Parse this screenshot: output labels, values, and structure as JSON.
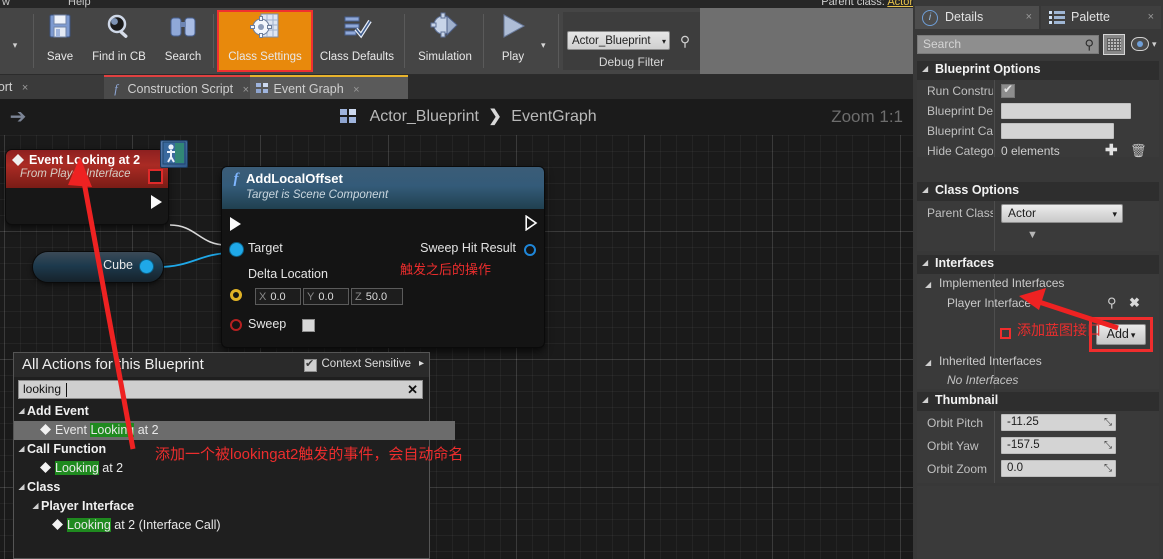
{
  "menubar": {
    "window": "w",
    "help": "Help"
  },
  "toolbar": {
    "items": [
      {
        "label": "Save",
        "icon": "floppy-disk-icon",
        "glyph": "💾"
      },
      {
        "label": "Find in CB",
        "icon": "magnifier-icon",
        "glyph": "🔍"
      },
      {
        "label": "Search",
        "icon": "binoculars-icon",
        "glyph": "🔭"
      },
      {
        "label": "Class Settings",
        "icon": "gear-document-icon",
        "glyph": "⚙"
      },
      {
        "label": "Class Defaults",
        "icon": "checklist-icon",
        "glyph": "🗒"
      },
      {
        "label": "Simulation",
        "icon": "gear-play-icon",
        "glyph": "⚙"
      },
      {
        "label": "Play",
        "icon": "play-icon",
        "glyph": "▶"
      }
    ],
    "active_item": "Class Settings",
    "debug_filter": {
      "label": "Debug Filter",
      "value": "Actor_Blueprint",
      "search_icon": "magnifier-icon"
    },
    "parent_class_text": "Parent class: ",
    "parent_class_value": "Actor"
  },
  "tabs": [
    {
      "label": "Viewport",
      "icon": "viewport-icon",
      "close": "×"
    },
    {
      "label": "Construction Script",
      "icon": "function-icon",
      "close": "×"
    },
    {
      "label": "Event Graph",
      "icon": "event-graph-icon",
      "close": "×"
    }
  ],
  "graph": {
    "back_arrow_icon": "arrow-right-icon",
    "breadcrumb": {
      "icon": "event-graph-icon",
      "root": "Actor_Blueprint",
      "separator": "❯",
      "leaf": "EventGraph"
    },
    "zoom_label": "Zoom 1:1",
    "event_node": {
      "title": "Event Looking at 2",
      "subtitle": "From Player Interface",
      "badge_icon": "actor-interface-badge-icon",
      "badge_glyph": "🧍",
      "exec_out_icon": "exec-pin-icon"
    },
    "cube_node": {
      "label": "Cube",
      "pin_icon": "object-pin-icon"
    },
    "function_node": {
      "title": "AddLocalOffset",
      "subtitle": "Target is Scene Component",
      "fn_icon": "function-f-icon",
      "exec_in_icon": "exec-pin-icon",
      "exec_out_icon": "exec-pin-icon",
      "inputs": [
        {
          "name": "Target",
          "pin": "object-pin-icon"
        },
        {
          "name": "Delta Location",
          "pin": "struct-pin-icon"
        },
        {
          "name": "Sweep",
          "pin": "bool-pin-icon"
        }
      ],
      "outputs": [
        {
          "name": "Sweep Hit Result",
          "pin": "struct-pin-icon"
        }
      ],
      "delta_location": {
        "x_axis": "X",
        "x": "0.0",
        "y_axis": "Y",
        "y": "0.0",
        "z_axis": "Z",
        "z": "50.0"
      },
      "sweep_checked": false
    }
  },
  "actions_menu": {
    "title": "All Actions for this Blueprint",
    "context_sensitive_label": "Context Sensitive",
    "context_sensitive_checked": true,
    "context_arrow": "▸",
    "search_value": "looking",
    "clear_icon": "✕",
    "tree": [
      {
        "depth": 0,
        "type": "category",
        "twisty": "◢",
        "label": "Add Event"
      },
      {
        "depth": 1,
        "type": "item",
        "icon": "event-diamond-icon",
        "pre": "Event ",
        "hl": "Looking",
        "post": " at 2",
        "selected": true
      },
      {
        "depth": 0,
        "type": "category",
        "twisty": "◢",
        "label": "Call Function"
      },
      {
        "depth": 1,
        "type": "item",
        "icon": "event-diamond-icon",
        "pre": "",
        "hl": "Looking",
        "post": " at 2",
        "selected": false
      },
      {
        "depth": 0,
        "type": "category",
        "twisty": "◢",
        "label": "Class"
      },
      {
        "depth": 1,
        "type": "category",
        "twisty": "◢",
        "label": "Player Interface"
      },
      {
        "depth": 2,
        "type": "item",
        "icon": "event-diamond-icon",
        "pre": "",
        "hl": "Looking",
        "post": " at 2 (Interface Call)",
        "selected": false
      }
    ]
  },
  "annotations": [
    {
      "id": "after-trigger",
      "text": "触发之后的操作",
      "color": "#ec2d2d"
    },
    {
      "id": "auto-name",
      "text": "添加一个被lookingat2触发的事件，会自动命名",
      "color": "#ec2d2d"
    },
    {
      "id": "add-blueprint-interface",
      "text": "添加蓝图接口",
      "color": "#ec2d2d"
    }
  ],
  "right_panel": {
    "tabs": [
      {
        "label": "Details",
        "icon": "details-info-icon",
        "close": "×",
        "active": true
      },
      {
        "label": "Palette",
        "icon": "palette-list-icon",
        "close": "×",
        "active": false
      }
    ],
    "search": {
      "placeholder": "Search",
      "icon": "magnifier-icon"
    },
    "grid_button_icon": "grid-view-icon",
    "eye_icon": "eye-icon",
    "eye_caret": "▾",
    "sections": [
      {
        "id": "blueprint-options",
        "title": "Blueprint Options",
        "twisty": "◢",
        "rows": [
          {
            "label": "Run Constru",
            "type": "checkbox",
            "checked": true
          },
          {
            "label": "Blueprint De",
            "type": "text",
            "value": ""
          },
          {
            "label": "Blueprint Ca",
            "type": "text",
            "value": ""
          },
          {
            "label": "Hide Catego",
            "type": "array",
            "value": "0 elements",
            "add_icon": "plus-icon",
            "delete_icon": "trash-icon"
          }
        ]
      },
      {
        "id": "class-options",
        "title": "Class Options",
        "twisty": "◢",
        "rows": [
          {
            "label": "Parent Class",
            "type": "combo",
            "value": "Actor",
            "caret": "▾"
          }
        ],
        "expander": "▼"
      },
      {
        "id": "interfaces",
        "title": "Interfaces",
        "twisty": "◢",
        "groups": [
          {
            "label": "Implemented Interfaces",
            "twisty": "◢",
            "items": [
              "Player Interface"
            ],
            "row_icons": {
              "browse": "magnifier-icon",
              "remove": "close-x-icon"
            },
            "add_button": {
              "label": "Add",
              "caret": "▾"
            }
          },
          {
            "label": "Inherited Interfaces",
            "twisty": "◢",
            "items": [
              "No Interfaces"
            ],
            "italic": true
          }
        ]
      },
      {
        "id": "thumbnail",
        "title": "Thumbnail",
        "twisty": "◢",
        "rows": [
          {
            "label": "Orbit Pitch",
            "type": "number",
            "value": "-11.25",
            "spinner": "⤡"
          },
          {
            "label": "Orbit Yaw",
            "type": "number",
            "value": "-157.5",
            "spinner": "⤡"
          },
          {
            "label": "Orbit Zoom",
            "type": "number",
            "value": "0.0",
            "spinner": "⤡"
          }
        ]
      }
    ]
  },
  "colors": {
    "accent_orange": "#e8890c",
    "annotation_red": "#ec2d2d",
    "highlight_green": "#1f8a1f",
    "panel_bg": "#383838",
    "graph_bg": "#1a1a1a",
    "event_node_red": "#aa2b24",
    "function_node_blue": "#345b79",
    "exec_wire": "#d8d8d8",
    "data_wire_blue": "#1fa8e8"
  }
}
